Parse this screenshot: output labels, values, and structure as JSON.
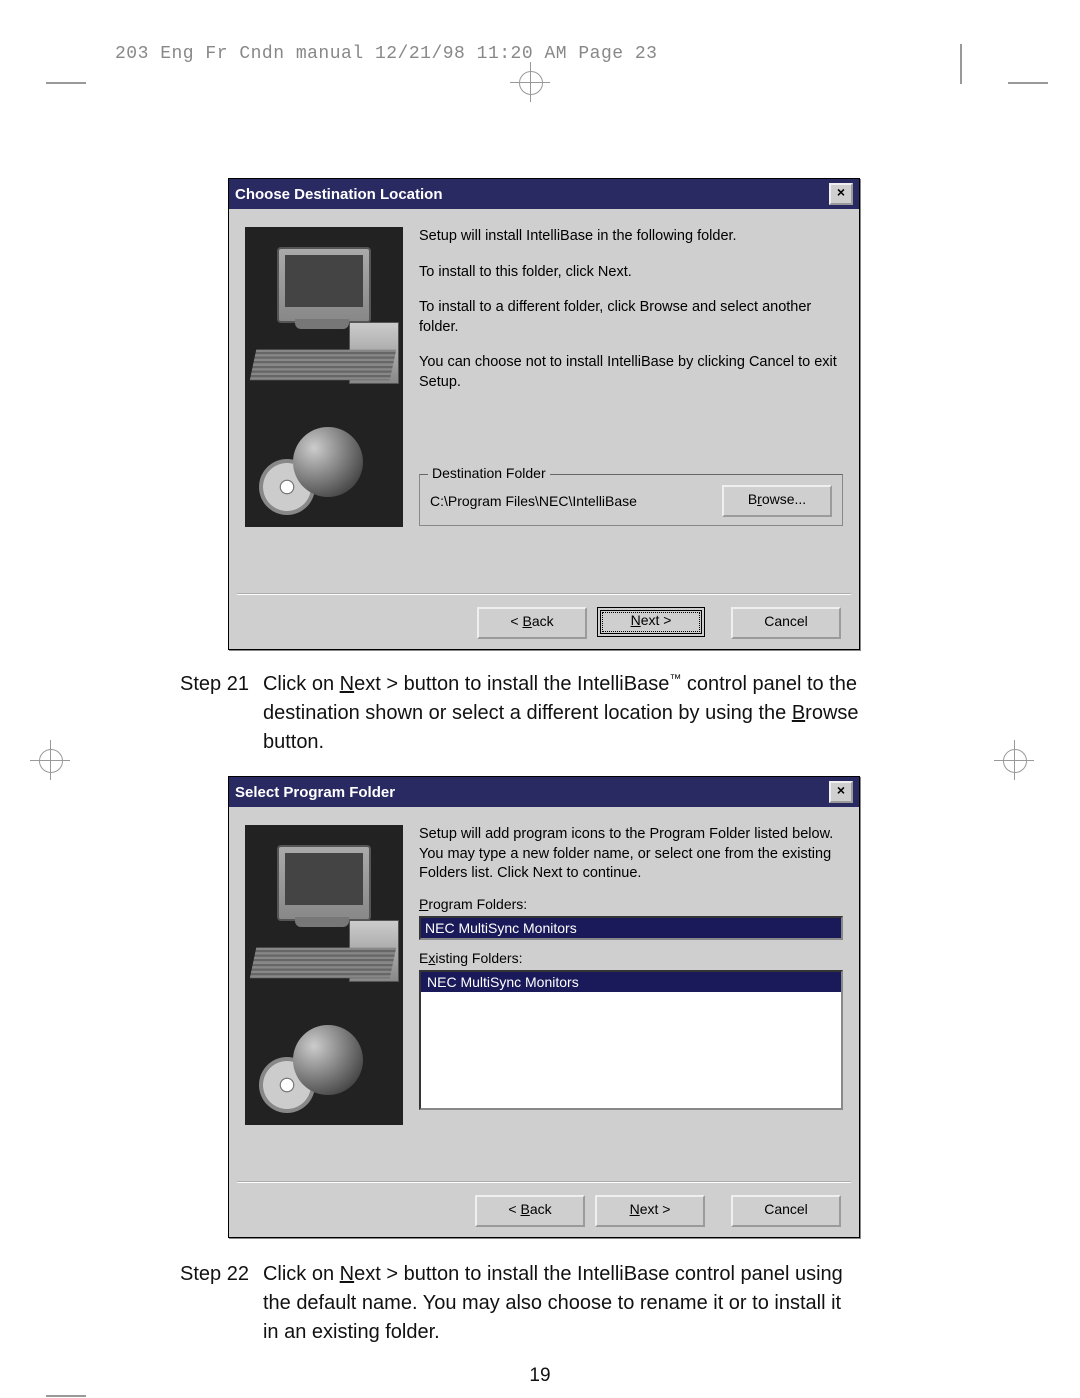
{
  "header": "203 Eng Fr Cndn manual  12/21/98 11:20 AM  Page 23",
  "page_number": "19",
  "dialog1": {
    "title": "Choose Destination Location",
    "close": "×",
    "lines": {
      "l1": "Setup will install IntelliBase in the following folder.",
      "l2": "To install to this folder, click Next.",
      "l3": "To install to a different folder, click Browse and select another folder.",
      "l4": "You can choose not to install IntelliBase by clicking Cancel to exit Setup."
    },
    "group_legend": "Destination Folder",
    "path": "C:\\Program Files\\NEC\\IntelliBase",
    "browse": "Browse...",
    "back": "< Back",
    "next": "Next >",
    "cancel": "Cancel"
  },
  "step21": {
    "label": "Step 21",
    "text_prefix": "Click on ",
    "next_word": "Next >",
    "mid1": " button to install the IntelliBase",
    "tm": "™",
    "mid2": " control panel to the destination shown or select a different location by using the ",
    "browse_word": "Browse",
    "suffix": " button."
  },
  "dialog2": {
    "title": "Select Program Folder",
    "close": "×",
    "intro": "Setup will add program icons to the Program Folder listed below. You may type a new folder name, or select one from the existing Folders list.  Click Next to continue.",
    "pf_label": "Program Folders:",
    "pf_value": "NEC MultiSync Monitors",
    "ef_label": "Existing Folders:",
    "ef_item": "NEC MultiSync Monitors",
    "back": "< Back",
    "next": "Next >",
    "cancel": "Cancel"
  },
  "step22": {
    "label": "Step 22",
    "text_prefix": "Click on ",
    "next_word": "Next >",
    "rest": " button to install the IntelliBase control panel using the default name. You may also choose to rename it or to install it in an existing folder."
  }
}
